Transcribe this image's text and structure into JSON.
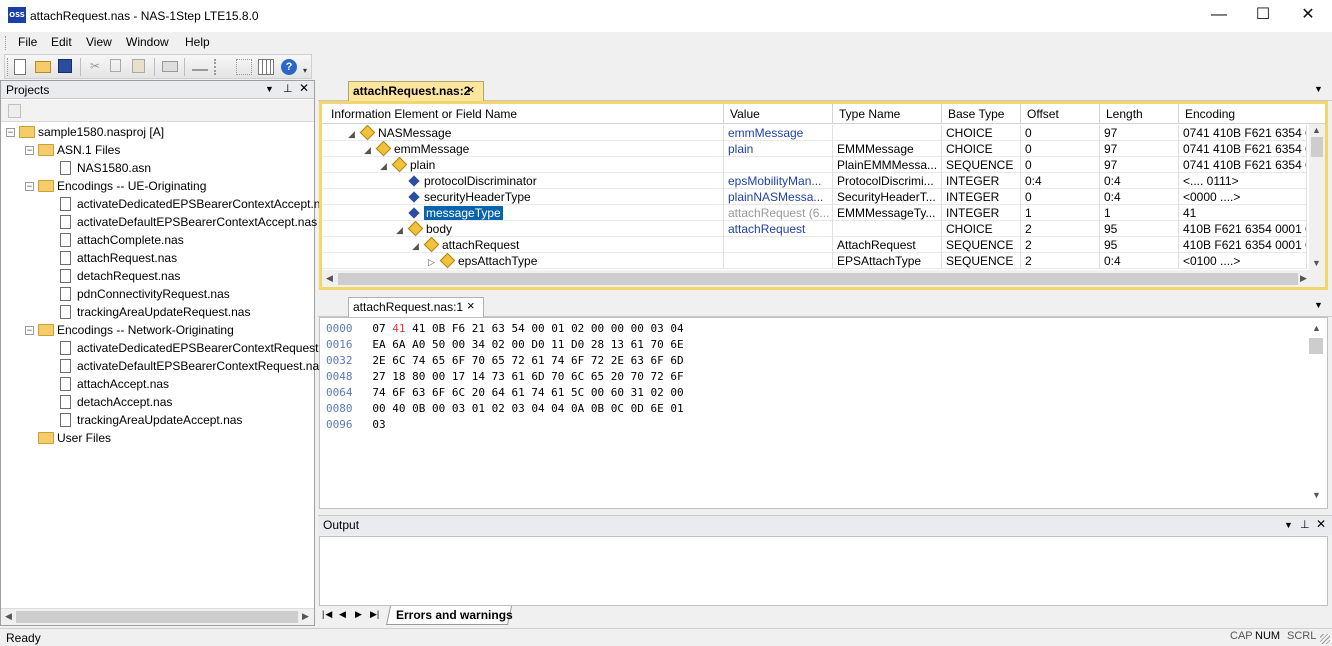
{
  "window": {
    "title": "attachRequest.nas - NAS-1Step LTE15.8.0",
    "app_icon_text": "OSS",
    "minimize": "—",
    "maximize": "☐",
    "close": "✕"
  },
  "menu": [
    "File",
    "Edit",
    "View",
    "Window",
    "Help"
  ],
  "toolbar_icons": [
    "new-icon",
    "open-icon",
    "save-icon",
    "cut-icon",
    "copy-icon",
    "paste-icon",
    "print-icon",
    "encode-icon",
    "decode-icon",
    "table-icon",
    "help-icon"
  ],
  "projects": {
    "title": "Projects",
    "tree": [
      {
        "label": "sample1580.nasproj [A]",
        "type": "folder",
        "indent": 0,
        "expander": "−"
      },
      {
        "label": "ASN.1 Files",
        "type": "folder",
        "indent": 1,
        "expander": "−"
      },
      {
        "label": "NAS1580.asn",
        "type": "file",
        "indent": 2
      },
      {
        "label": "Encodings -- UE-Originating",
        "type": "folder",
        "indent": 1,
        "expander": "−"
      },
      {
        "label": "activateDedicatedEPSBearerContextAccept.n",
        "type": "file",
        "indent": 2
      },
      {
        "label": "activateDefaultEPSBearerContextAccept.nas",
        "type": "file",
        "indent": 2
      },
      {
        "label": "attachComplete.nas",
        "type": "file",
        "indent": 2
      },
      {
        "label": "attachRequest.nas",
        "type": "file",
        "indent": 2
      },
      {
        "label": "detachRequest.nas",
        "type": "file",
        "indent": 2
      },
      {
        "label": "pdnConnectivityRequest.nas",
        "type": "file",
        "indent": 2
      },
      {
        "label": "trackingAreaUpdateRequest.nas",
        "type": "file",
        "indent": 2
      },
      {
        "label": "Encodings -- Network-Originating",
        "type": "folder",
        "indent": 1,
        "expander": "−"
      },
      {
        "label": "activateDedicatedEPSBearerContextRequest.",
        "type": "file",
        "indent": 2
      },
      {
        "label": "activateDefaultEPSBearerContextRequest.nas",
        "type": "file",
        "indent": 2
      },
      {
        "label": "attachAccept.nas",
        "type": "file",
        "indent": 2
      },
      {
        "label": "detachAccept.nas",
        "type": "file",
        "indent": 2
      },
      {
        "label": "trackingAreaUpdateAccept.nas",
        "type": "file",
        "indent": 2
      },
      {
        "label": "User Files",
        "type": "folder",
        "indent": 1
      }
    ]
  },
  "editor": {
    "tab_label": "attachRequest.nas:2",
    "tab_close": "×",
    "columns": [
      "Information Element or Field Name",
      "Value",
      "Type Name",
      "Base Type",
      "Offset",
      "Length",
      "Encoding"
    ],
    "rows": [
      {
        "indent": 0,
        "arrow": "◢",
        "icon": "ie",
        "name": "NASMessage",
        "value": "emmMessage",
        "value_style": "blue",
        "type": "",
        "base": "CHOICE",
        "offset": "0",
        "length": "97",
        "encoding": "0741 410B F621 6354 0..."
      },
      {
        "indent": 1,
        "arrow": "◢",
        "icon": "ie",
        "name": "emmMessage",
        "value": "plain",
        "value_style": "blue",
        "type": "EMMMessage",
        "base": "CHOICE",
        "offset": "0",
        "length": "97",
        "encoding": "0741 410B F621 6354 0..."
      },
      {
        "indent": 2,
        "arrow": "◢",
        "icon": "ie",
        "name": "plain",
        "value": "",
        "value_style": "blue",
        "type": "PlainEMMMessa...",
        "base": "SEQUENCE",
        "offset": "0",
        "length": "97",
        "encoding": "0741 410B F621 6354 0..."
      },
      {
        "indent": 3,
        "arrow": "",
        "icon": "field",
        "name": "protocolDiscriminator",
        "value": "epsMobilityMan...",
        "value_style": "blue",
        "type": "ProtocolDiscrimi...",
        "base": "INTEGER",
        "offset": "0:4",
        "length": "0:4",
        "encoding": "<.... 0111>"
      },
      {
        "indent": 3,
        "arrow": "",
        "icon": "field",
        "name": "securityHeaderType",
        "value": "plainNASMessa...",
        "value_style": "blue",
        "type": "SecurityHeaderT...",
        "base": "INTEGER",
        "offset": "0",
        "length": "0:4",
        "encoding": "<0000 ....>"
      },
      {
        "indent": 3,
        "arrow": "",
        "icon": "field",
        "name": "messageType",
        "value": "attachRequest (6...",
        "value_style": "grey",
        "type": "EMMMessageTy...",
        "base": "INTEGER",
        "offset": "1",
        "length": "1",
        "encoding": "41",
        "selected": true
      },
      {
        "indent": 3,
        "arrow": "◢",
        "icon": "ie",
        "name": "body",
        "value": "attachRequest",
        "value_style": "blue",
        "type": "",
        "base": "CHOICE",
        "offset": "2",
        "length": "95",
        "encoding": "410B F621 6354 0001 0..."
      },
      {
        "indent": 4,
        "arrow": "◢",
        "icon": "ie",
        "name": "attachRequest",
        "value": "",
        "value_style": "blue",
        "type": "AttachRequest",
        "base": "SEQUENCE",
        "offset": "2",
        "length": "95",
        "encoding": "410B F621 6354 0001 0..."
      },
      {
        "indent": 5,
        "arrow": "▷",
        "icon": "ie",
        "name": "epsAttachType",
        "value": "",
        "value_style": "blue",
        "type": "EPSAttachType",
        "base": "SEQUENCE",
        "offset": "2",
        "length": "0:4",
        "encoding": "<0100 ....>"
      }
    ]
  },
  "hex": {
    "tab_label": "attachRequest.nas:1",
    "tab_close": "×",
    "lines": [
      {
        "offset": "0000",
        "pre": "07 ",
        "hl": "41",
        "post": " 41 0B F6 21 63 54 00 01 02 00 00 00 03 04"
      },
      {
        "offset": "0016",
        "pre": "EA 6A A0 50 00 34 02 00 D0 11 D0 28 13 61 70 6E",
        "hl": "",
        "post": ""
      },
      {
        "offset": "0032",
        "pre": "2E 6C 74 65 6F 70 65 72 61 74 6F 72 2E 63 6F 6D",
        "hl": "",
        "post": ""
      },
      {
        "offset": "0048",
        "pre": "27 18 80 00 17 14 73 61 6D 70 6C 65 20 70 72 6F",
        "hl": "",
        "post": ""
      },
      {
        "offset": "0064",
        "pre": "74 6F 63 6F 6C 20 64 61 74 61 5C 00 60 31 02 00",
        "hl": "",
        "post": ""
      },
      {
        "offset": "0080",
        "pre": "00 40 0B 00 03 01 02 03 04 04 0A 0B 0C 0D 6E 01",
        "hl": "",
        "post": ""
      },
      {
        "offset": "0096",
        "pre": "03",
        "hl": "",
        "post": ""
      }
    ]
  },
  "output": {
    "title": "Output",
    "tab_label": "Errors and warnings",
    "nav": [
      "|◀",
      "◀",
      "▶",
      "▶|"
    ]
  },
  "status": {
    "text": "Ready",
    "indicators": [
      "CAP",
      "NUM",
      "SCRL"
    ]
  }
}
